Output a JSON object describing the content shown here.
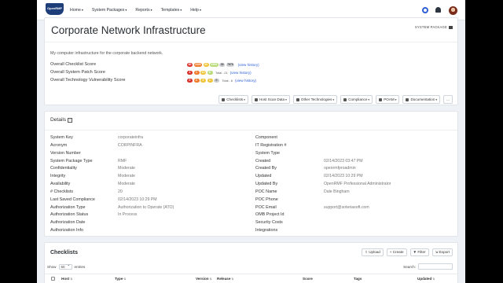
{
  "nav": {
    "logo_text": "OpenRMF",
    "menu": [
      "Home",
      "System Packages",
      "Reports",
      "Templates",
      "Help"
    ]
  },
  "header": {
    "title": "Corporate Network Infrastructure",
    "type_label": "SYSTEM PACKAGE",
    "description": "My computer infrastructure for the corporate backend network.",
    "checklist_score_label": "Overall Checklist Score",
    "patch_score_label": "Overall System Patch Score",
    "vuln_score_label": "Overall Technology Vulnerability Score",
    "checklist_pills": [
      "60",
      "1029",
      "44",
      "1963",
      "33",
      "7878"
    ],
    "patch_pills": [
      "4",
      "1",
      "12",
      "6"
    ],
    "patch_total": "Total - 21",
    "vuln_pills": [
      "0",
      "2",
      "3",
      "1",
      "0"
    ],
    "vuln_total": "Total - 6",
    "view_history": "(view history)",
    "colors": {
      "critical": "#d9322c",
      "high": "#ef7d2b",
      "medium": "#f0c43a",
      "low": "#b9db7c",
      "info": "#c9ccd0",
      "na": "#d4d7da",
      "link": "#2d5fd8"
    }
  },
  "toolbar": [
    "Checklists",
    "Host Scan Data",
    "Other Technologies",
    "Compliance",
    "POAM",
    "Documentation",
    "..."
  ],
  "details": {
    "title": "Details",
    "left": [
      {
        "k": "System Key",
        "v": "corporateinfra"
      },
      {
        "k": "Acronym",
        "v": "CORPINFRA"
      },
      {
        "k": "Version Number",
        "v": ""
      },
      {
        "k": "System Package Type",
        "v": "RMF"
      },
      {
        "k": "Confidentiality",
        "v": "Moderate"
      },
      {
        "k": "Integrity",
        "v": "Moderate"
      },
      {
        "k": "Availability",
        "v": "Moderate"
      },
      {
        "k": "# Checklists",
        "v": "20"
      },
      {
        "k": "Last Saved Compliance",
        "v": "02/14/2023 10:29 PM"
      },
      {
        "k": "Authorization Type",
        "v": "Authorization to Operate (ATO)"
      },
      {
        "k": "Authorization Status",
        "v": "In Process"
      },
      {
        "k": "Authorization Date",
        "v": ""
      },
      {
        "k": "Authorization Info",
        "v": ""
      }
    ],
    "right": [
      {
        "k": "Component",
        "v": ""
      },
      {
        "k": "IT Registration #",
        "v": ""
      },
      {
        "k": "System Type",
        "v": ""
      },
      {
        "k": "Created",
        "v": "02/14/2023 03:47 PM"
      },
      {
        "k": "Created By",
        "v": "openrmfproadmin"
      },
      {
        "k": "Updated",
        "v": "02/14/2023 10:29 PM"
      },
      {
        "k": "Updated By",
        "v": "OpenRMF Professional Administrator"
      },
      {
        "k": "POC Name",
        "v": "Dale Bingham"
      },
      {
        "k": "POC Phone",
        "v": ""
      },
      {
        "k": "POC Email",
        "v": "support@soteriasoft.com"
      },
      {
        "k": "OMB Project Id",
        "v": ""
      },
      {
        "k": "Security Costs",
        "v": ""
      },
      {
        "k": "Integrations",
        "v": ""
      }
    ]
  },
  "checklists": {
    "title": "Checklists",
    "buttons": [
      "Upload",
      "+ Create",
      "Filter",
      "Export"
    ],
    "show_label": "Show",
    "show_value": "50",
    "entries_label": "entries",
    "search_label": "Search:",
    "columns": [
      "Host",
      "Type",
      "Version",
      "Release",
      "Score",
      "Tags",
      "Updated"
    ]
  }
}
